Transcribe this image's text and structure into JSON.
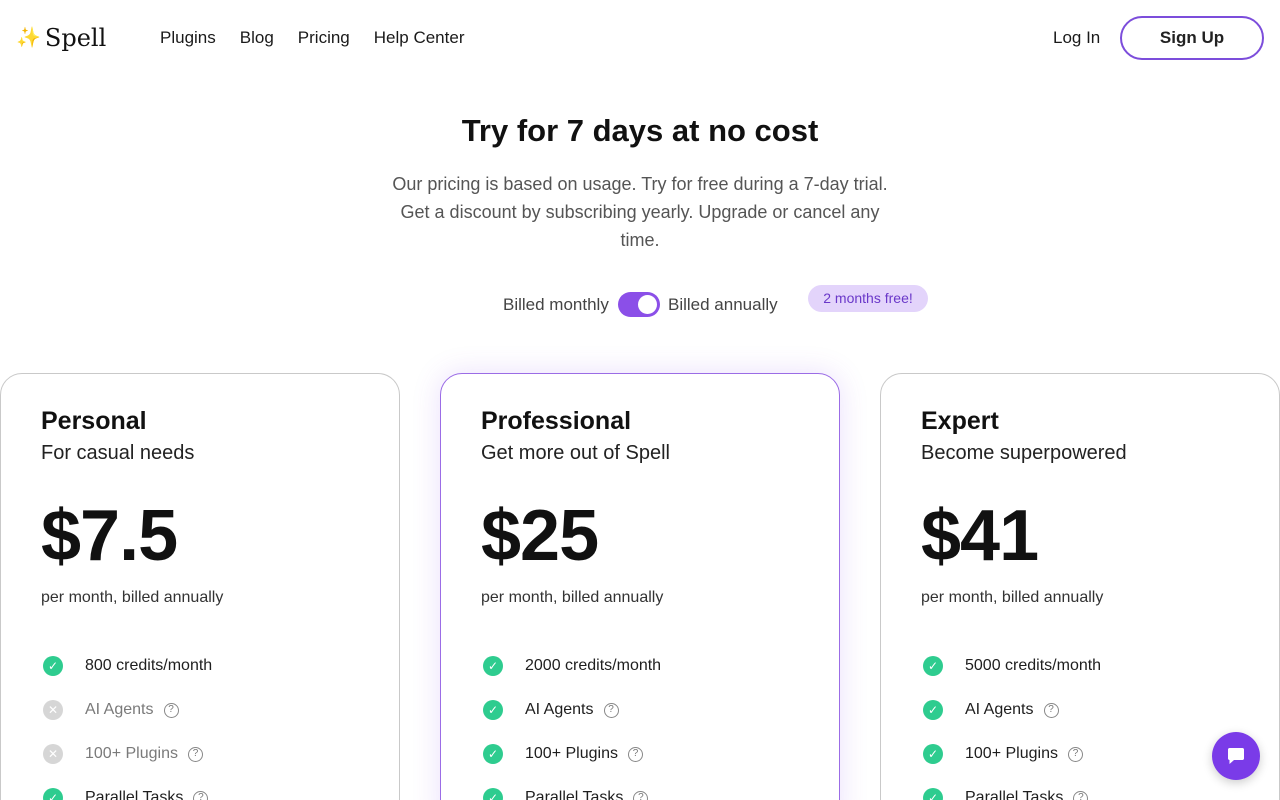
{
  "header": {
    "logo_icon": "sparkles-icon",
    "logo_text": "Spell",
    "nav": [
      "Plugins",
      "Blog",
      "Pricing",
      "Help Center"
    ],
    "login_label": "Log In",
    "signup_label": "Sign Up"
  },
  "hero": {
    "title": "Try for 7 days at no cost",
    "subtitle": "Our pricing is based on usage. Try for free during a 7-day trial. Get a discount by subscribing yearly. Upgrade or cancel any time."
  },
  "billing": {
    "monthly_label": "Billed monthly",
    "annual_label": "Billed annually",
    "selected": "annual",
    "promo": "2 months free!"
  },
  "plans": [
    {
      "name": "Personal",
      "tagline": "For casual needs",
      "price": "$7.5",
      "price_note": "per month, billed annually",
      "features": [
        {
          "text": "800 credits/month",
          "included": true,
          "help": false
        },
        {
          "text": "AI Agents",
          "included": false,
          "help": true
        },
        {
          "text": "100+ Plugins",
          "included": false,
          "help": true
        },
        {
          "text": "Parallel Tasks",
          "included": true,
          "help": true
        }
      ]
    },
    {
      "name": "Professional",
      "tagline": "Get more out of Spell",
      "price": "$25",
      "price_note": "per month, billed annually",
      "featured": true,
      "features": [
        {
          "text": "2000 credits/month",
          "included": true,
          "help": false
        },
        {
          "text": "AI Agents",
          "included": true,
          "help": true
        },
        {
          "text": "100+ Plugins",
          "included": true,
          "help": true
        },
        {
          "text": "Parallel Tasks",
          "included": true,
          "help": true
        }
      ]
    },
    {
      "name": "Expert",
      "tagline": "Become superpowered",
      "price": "$41",
      "price_note": "per month, billed annually",
      "features": [
        {
          "text": "5000 credits/month",
          "included": true,
          "help": false
        },
        {
          "text": "AI Agents",
          "included": true,
          "help": true
        },
        {
          "text": "100+ Plugins",
          "included": true,
          "help": true
        },
        {
          "text": "Parallel Tasks",
          "included": true,
          "help": true
        }
      ]
    }
  ],
  "colors": {
    "accent": "#8b4fe8",
    "check": "#2ecc8f",
    "promo_bg": "#e3d4fb"
  },
  "chat_icon": "chat-bubble-icon"
}
